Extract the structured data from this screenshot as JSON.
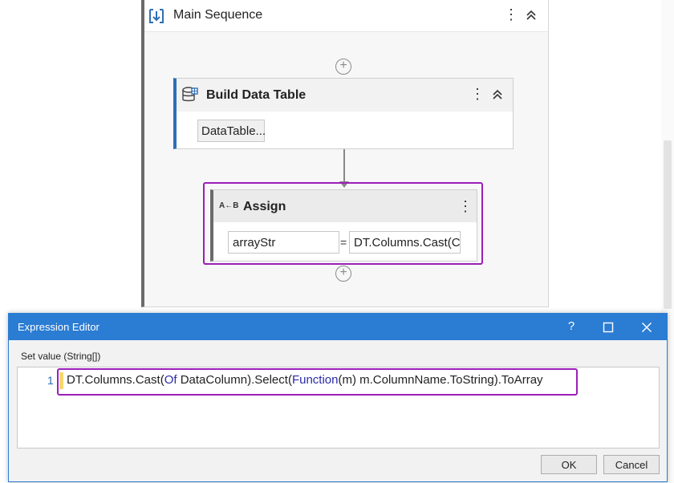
{
  "main_sequence": {
    "title": "Main Sequence"
  },
  "build_data_table": {
    "title": "Build Data Table",
    "button_label": "DataTable..."
  },
  "assign": {
    "title": "Assign",
    "icon_text": "A←B",
    "to_value": "arrayStr",
    "equals": "=",
    "value_preview": "DT.Columns.Cast(C"
  },
  "expression_editor": {
    "title": "Expression Editor",
    "help": "?",
    "set_value_label": "Set value (String[])",
    "line_number": "1",
    "code": {
      "part1": "DT.Columns.Cast(",
      "kw1": "Of",
      "part2": " DataColumn).Select(",
      "kw2": "Function",
      "part3": "(m) m.ColumnName.ToString).ToArray"
    },
    "ok_label": "OK",
    "cancel_label": "Cancel"
  },
  "icons": [
    "sequence-icon",
    "kebab-menu-icon",
    "collapse-icon",
    "add-activity-icon",
    "data-table-icon",
    "assign-icon",
    "maximize-icon",
    "close-icon"
  ],
  "colors": {
    "accent": "#2b7cd3",
    "highlight": "#9b1fb8",
    "keyword": "#2a2aa8",
    "build_border": "#2f6fb5"
  }
}
